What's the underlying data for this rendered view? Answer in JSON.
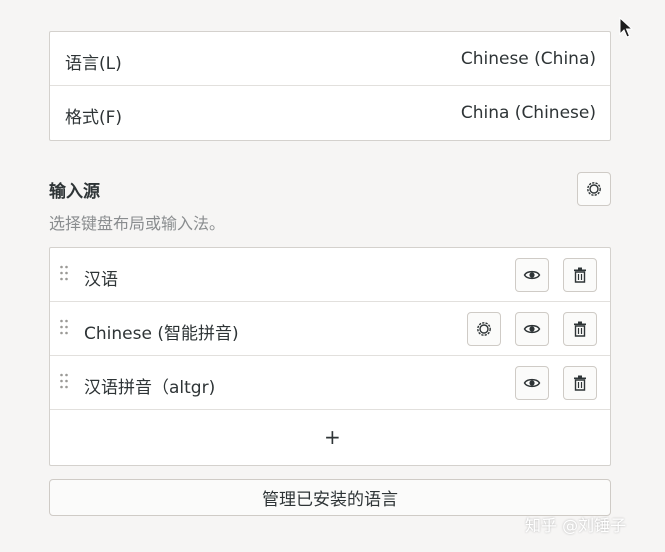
{
  "language_card": {
    "rows": [
      {
        "label": "语言(L)",
        "value": "Chinese (China)"
      },
      {
        "label": "格式(F)",
        "value": "China (Chinese)"
      }
    ]
  },
  "input_sources": {
    "title": "输入源",
    "subtitle": "选择键盘布局或输入法。",
    "settings_icon": "gear-icon",
    "items": [
      {
        "label": "汉语",
        "icons": [
          "eye-icon",
          "trash-icon"
        ]
      },
      {
        "label": "Chinese (智能拼音)",
        "icons": [
          "gear-icon",
          "eye-icon",
          "trash-icon"
        ]
      },
      {
        "label": "汉语拼音（altgr)",
        "icons": [
          "eye-icon",
          "trash-icon"
        ]
      }
    ],
    "add_label": "+"
  },
  "manage_button": {
    "label": "管理已安装的语言"
  },
  "watermark": "知乎 @刘锤子"
}
